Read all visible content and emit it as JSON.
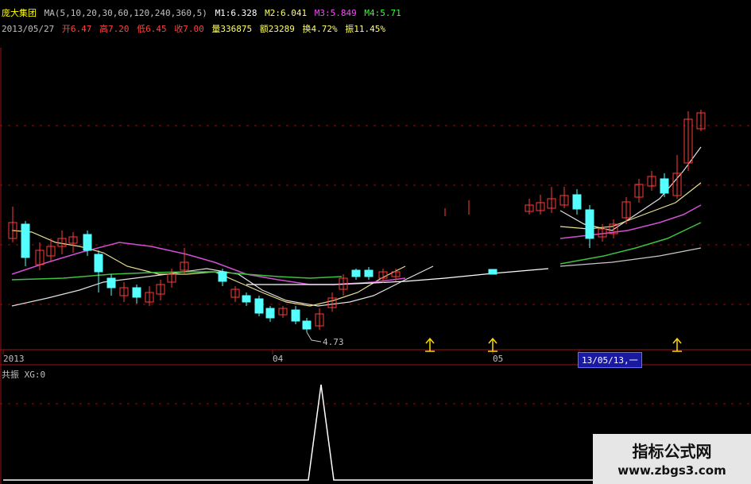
{
  "header": {
    "stock_name": "庞大集团",
    "ma_params": "MA(5,10,20,30,60,120,240,360,5)",
    "m1": "M1:6.328",
    "m2": "M2:6.041",
    "m3": "M3:5.849",
    "m4": "M4:5.71",
    "date": "2013/05/27",
    "open": "开6.47",
    "high": "高7.20",
    "low": "低6.45",
    "close": "收7.00",
    "volume": "量336875",
    "amount": "额23289",
    "turnover": "换4.72%",
    "amplitude": "振11.45%"
  },
  "colors": {
    "up": "#ff3b3b",
    "down": "#54ffff",
    "ma1": "#ffffff",
    "ma2": "#ffff66",
    "ma3": "#ff44ff",
    "ma4": "#33ff33",
    "grid": "#8a1010",
    "signal": "#ffd700"
  },
  "axis": {
    "year": "2013",
    "m04": "04",
    "m05": "05"
  },
  "date_tooltip": "13/05/13,一",
  "low_label": "4.73",
  "indicator": {
    "title": "共振 XG:0"
  },
  "watermark": {
    "line1": "指标公式网",
    "line2": "www.zbgs3.com"
  }
}
